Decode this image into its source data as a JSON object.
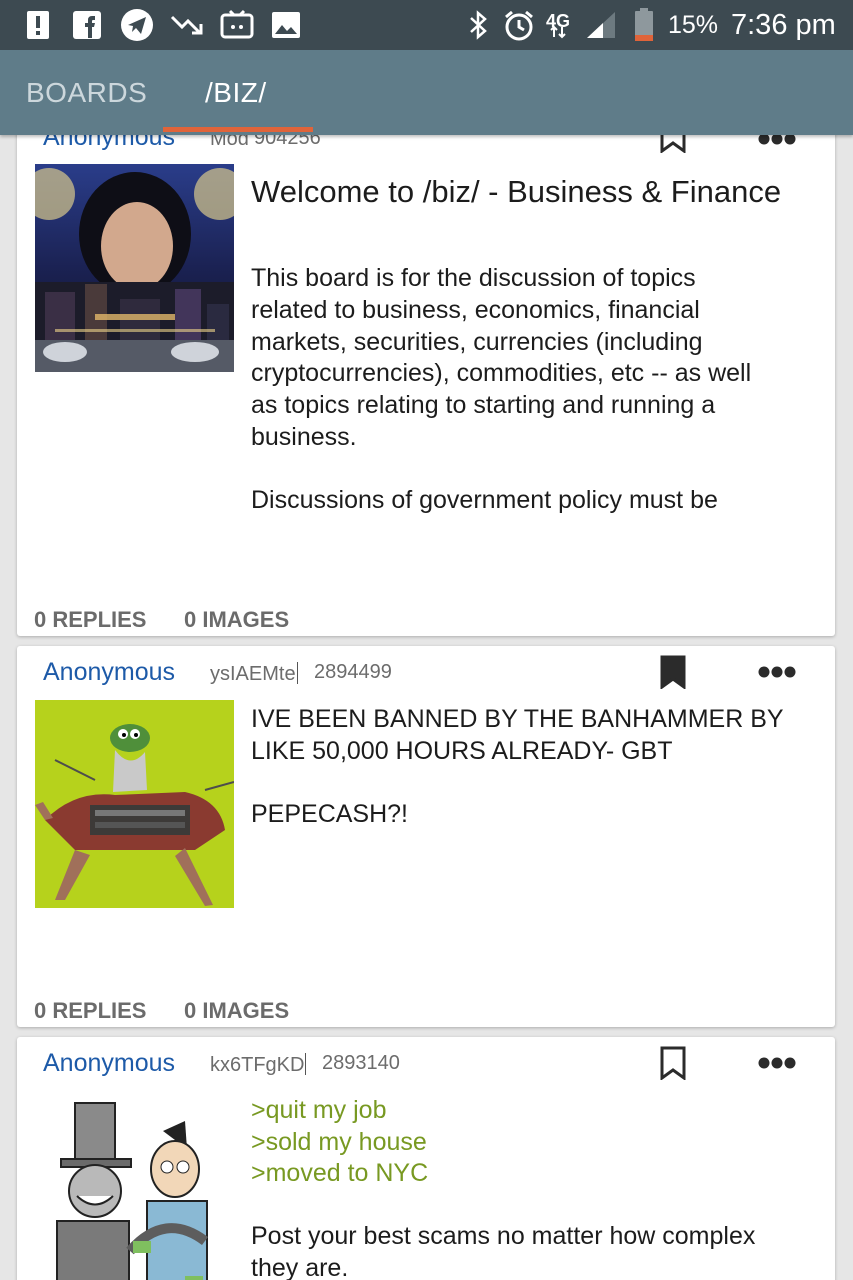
{
  "status_bar": {
    "icons": [
      "alert-icon",
      "facebook-icon",
      "telegram-icon",
      "trending-down-icon",
      "cast-icon",
      "image-icon",
      "bluetooth-icon",
      "alarm-icon",
      "4g-lte-icon",
      "signal-icon",
      "battery-icon"
    ],
    "network": "4G",
    "battery": "15%",
    "time": "7:36 pm"
  },
  "toolbar": {
    "tabs": [
      {
        "label": "BOARDS",
        "active": false
      },
      {
        "label": "/BIZ/",
        "active": true
      }
    ],
    "accent_color": "#e0643a"
  },
  "threads": [
    {
      "author": "Anonymous",
      "poster_id": "Mod",
      "post_no": "904256",
      "bookmarked": false,
      "thumbnail": "woman-over-city-skyline",
      "title": "Welcome to /biz/ - Business & Finance",
      "body": [
        "This board is for the discussion of topics",
        "related to business, economics, financial",
        "markets, securities, currencies (including",
        "cryptocurrencies), commodities, etc -- as well",
        "as topics relating to starting and running a",
        "business.",
        "",
        "Discussions of government policy must be"
      ],
      "replies": "0 REPLIES",
      "images": "0 IMAGES"
    },
    {
      "author": "Anonymous",
      "poster_id": "ysIAEMte",
      "post_no": "2894499",
      "bookmarked": true,
      "thumbnail": "pepe-riding-camel",
      "body": [
        "IVE BEEN BANNED BY THE BANHAMMER BY",
        "LIKE 50,000 HOURS ALREADY- GBT",
        "",
        "PEPECASH?!"
      ],
      "replies": "0 REPLIES",
      "images": "0 IMAGES"
    },
    {
      "author": "Anonymous",
      "poster_id": "kx6TFgKD",
      "post_no": "2893140",
      "bookmarked": false,
      "thumbnail": "top-hat-cartoon-scam",
      "greentext": [
        ">quit my job",
        ">sold my house",
        ">moved to NYC"
      ],
      "body": [
        "Post your best scams no matter how complex",
        "they are."
      ]
    }
  ],
  "colors": {
    "author": "#1d5aa8",
    "greentext": "#789922",
    "toolbar": "#5f7c89",
    "status_bar": "#3d4a51"
  }
}
